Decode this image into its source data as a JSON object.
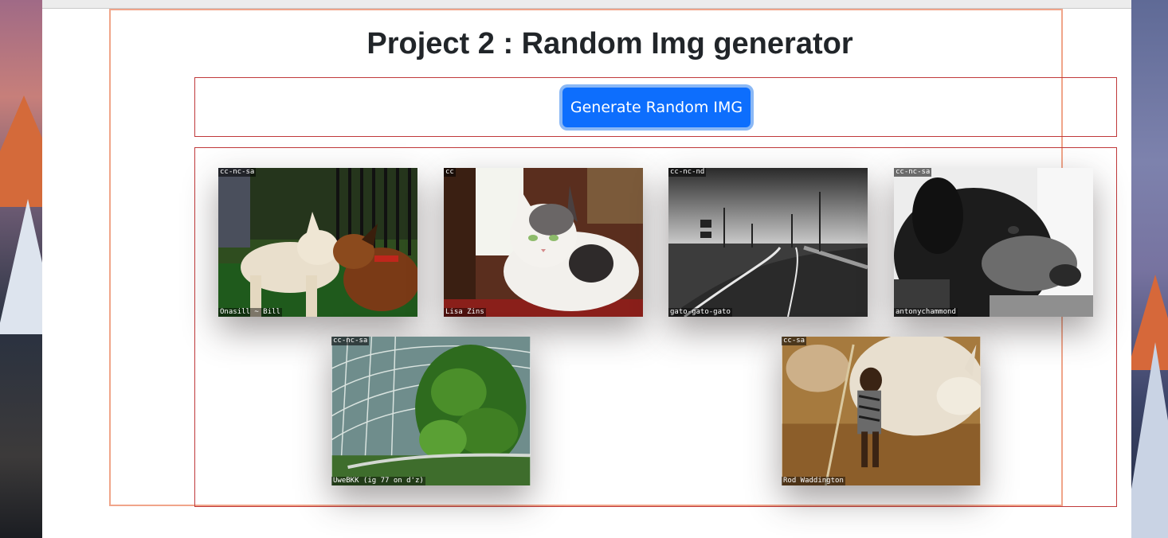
{
  "page": {
    "title": "Project 2 : Random Img generator",
    "button_label": "Generate Random IMG"
  },
  "colors": {
    "outer_border": "#f0a58a",
    "inner_border": "#c0393b",
    "button": "#0d6efd"
  },
  "gallery": [
    {
      "license": "cc-nc-sa",
      "credit": "Onasill ~ Bill",
      "subject": "two-dogs"
    },
    {
      "license": "cc",
      "credit": "Lisa Zins",
      "subject": "cat"
    },
    {
      "license": "cc-nc-nd",
      "credit": "gato-gato-gato",
      "subject": "road"
    },
    {
      "license": "cc-nc-sa",
      "credit": "antonychammond",
      "subject": "dog-portrait"
    },
    {
      "license": "cc-nc-sa",
      "credit": "UweBKK (ig 77 on d'z)",
      "subject": "garden-dome"
    },
    {
      "license": "cc-sa",
      "credit": "Rod Waddington",
      "subject": "child-cattle"
    }
  ]
}
